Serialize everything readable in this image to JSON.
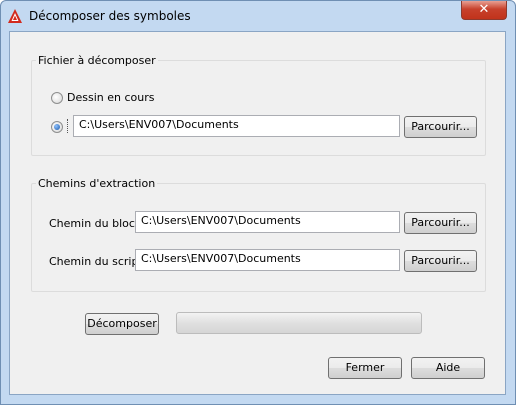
{
  "window": {
    "title": "Décomposer des symboles",
    "close_glyph": "✕"
  },
  "file_group": {
    "label": "Fichier à décomposer",
    "option_current": "Dessin en cours",
    "path": "C:\\Users\\ENV007\\Documents",
    "browse": "Parcourir..."
  },
  "extract_group": {
    "label": "Chemins d'extraction",
    "block_label": "Chemin du bloc:",
    "block_path": "C:\\Users\\ENV007\\Documents",
    "block_browse": "Parcourir...",
    "script_label": "Chemin du script:",
    "script_path": "C:\\Users\\ENV007\\Documents",
    "script_browse": "Parcourir..."
  },
  "actions": {
    "decompose": "Décomposer",
    "progress": 0
  },
  "footer": {
    "close": "Fermer",
    "help": "Aide"
  },
  "colors": {
    "accent": "#c1331b",
    "frame": "#c3d9f1"
  }
}
